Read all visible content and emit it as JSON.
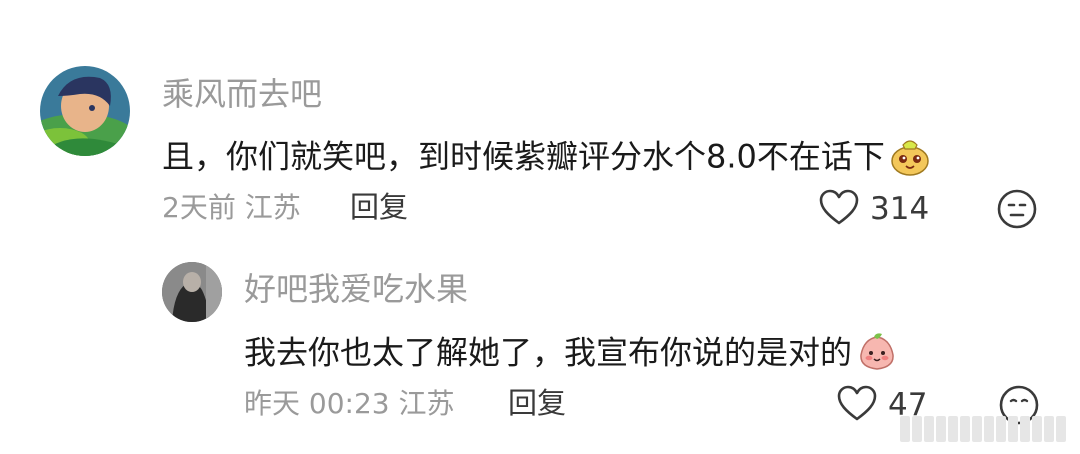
{
  "comments": [
    {
      "username": "乘风而去吧",
      "text": "且，你们就笑吧，到时候紫瓣评分水个8.0不在话下",
      "emoji": "face-sticker-emoji",
      "time": "2天前",
      "location": "江苏",
      "reply_label": "回复",
      "like_count": "314"
    }
  ],
  "reply": {
    "username": "好吧我爱吃水果",
    "text": "我去你也太了解她了，我宣布你说的是对的",
    "emoji": "peach-face-emoji",
    "time": "昨天 00:23",
    "location": "江苏",
    "reply_label": "回复",
    "like_count": "47"
  },
  "colors": {
    "username": "#9a9a9a",
    "text": "#1a1a1a",
    "meta": "#9a9a9a",
    "icon": "#3a3a3a"
  }
}
